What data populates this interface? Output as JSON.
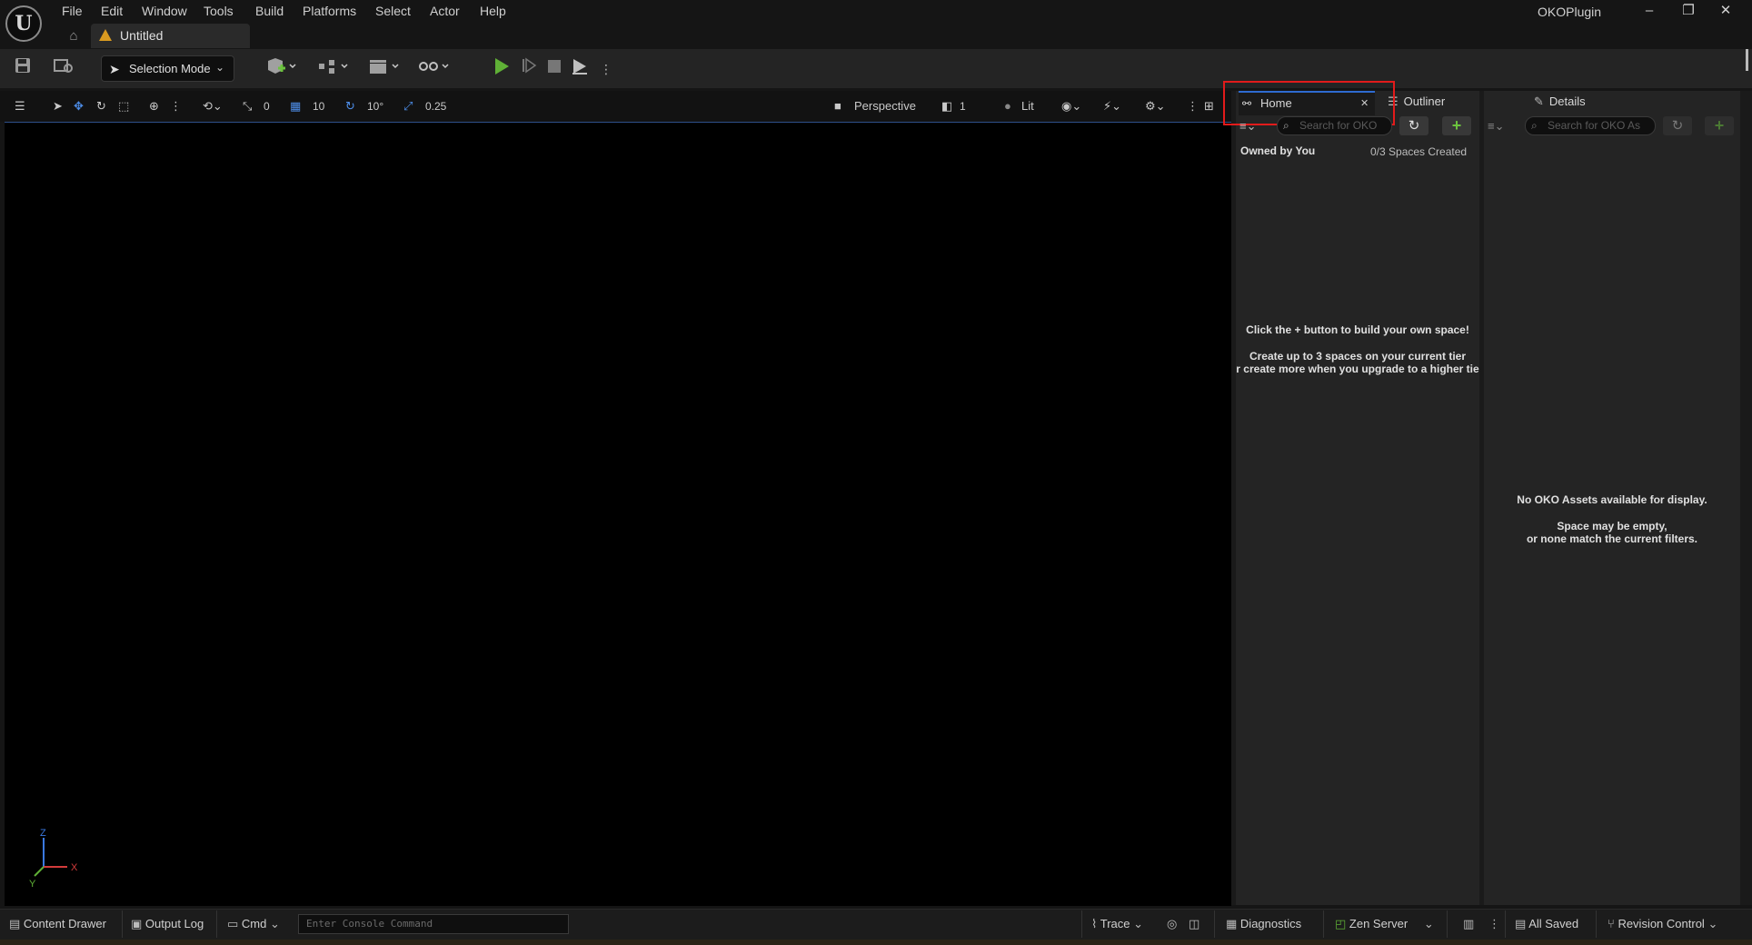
{
  "menu": {
    "items": [
      "File",
      "Edit",
      "Window",
      "Tools",
      "Build",
      "Platforms",
      "Select",
      "Actor",
      "Help"
    ]
  },
  "document_tab": {
    "title": "Untitled"
  },
  "project_name": "OKOPlugin",
  "toolbar": {
    "selection_mode": "Selection Mode"
  },
  "viewport_toolbar": {
    "translate_snap": "0",
    "grid_snap": "10",
    "rotate_snap": "10°",
    "scale_snap": "0.25",
    "view_mode": "Perspective",
    "camera_speed": "1",
    "lighting": "Lit"
  },
  "axis": {
    "z": "Z",
    "x": "X",
    "y": "Y"
  },
  "home_panel": {
    "tab_label": "Home",
    "search_placeholder": "Search for OKO",
    "owned_label": "Owned by You",
    "spaces_count": "0/3 Spaces Created",
    "message_line1": "Click the + button to build your own space!",
    "message_line2": "Create up to 3 spaces on your current tier",
    "message_line3": "r create more when you upgrade to a higher tie"
  },
  "outliner": {
    "tab_label": "Outliner"
  },
  "details_panel": {
    "tab_label": "Details",
    "search_placeholder": "Search for OKO As",
    "message_line1": "No OKO Assets available for display.",
    "message_line2": "Space may be empty,",
    "message_line3": "or none match the current filters."
  },
  "statusbar": {
    "content_drawer": "Content Drawer",
    "output_log": "Output Log",
    "cmd": "Cmd",
    "console_placeholder": "Enter Console Command",
    "trace": "Trace",
    "diagnostics": "Diagnostics",
    "zen_server": "Zen Server",
    "all_saved": "All Saved",
    "revision_control": "Revision Control"
  },
  "colors": {
    "accent_blue": "#2e6bd1",
    "play_green": "#5fb036",
    "plus_green": "#6cc33e",
    "highlight_red": "#e21b1b",
    "warning_orange": "#d99a20"
  }
}
